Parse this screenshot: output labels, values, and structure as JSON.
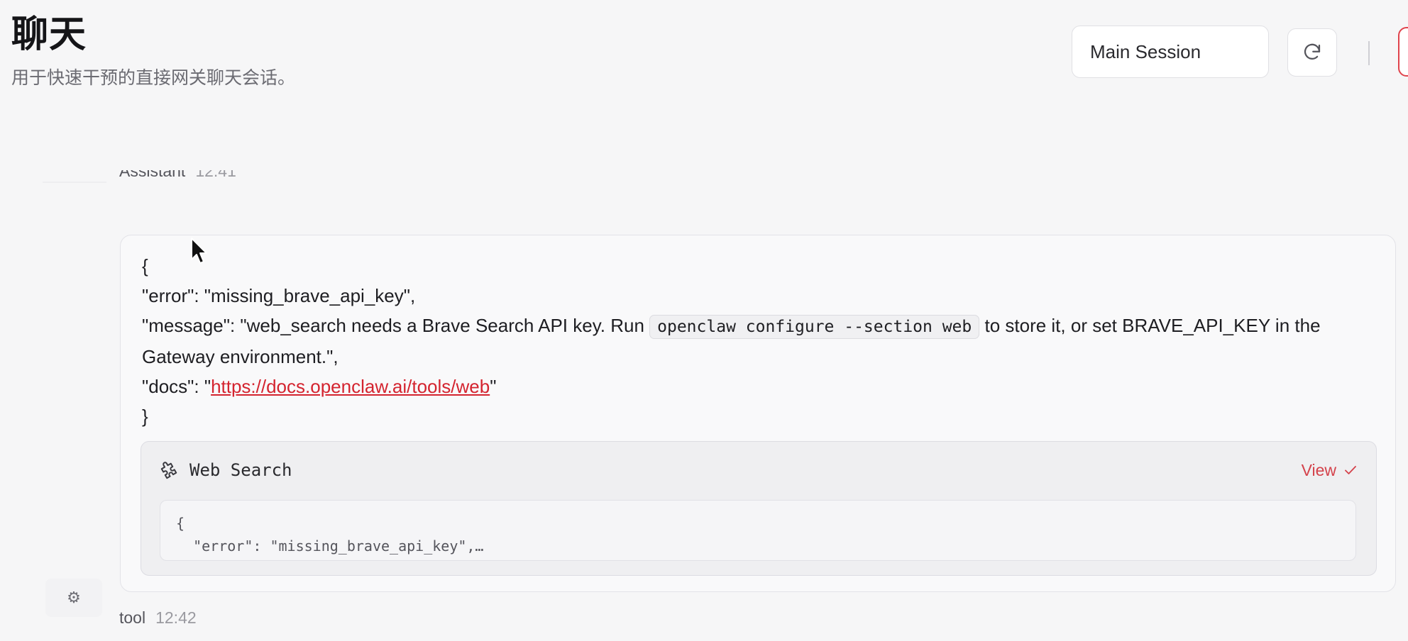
{
  "header": {
    "title": "聊天",
    "subtitle": "用于快速干预的直接网关聊天会话。",
    "session_select": "Main Session"
  },
  "messages": {
    "previous": {
      "sender": "Assistant",
      "time": "12:41"
    },
    "assistant": {
      "lines": {
        "open_brace": "{",
        "error_line": "\"error\": \"missing_brave_api_key\",",
        "message_prefix": "\"message\": \"web_search needs a Brave Search API key. Run ",
        "message_code": "openclaw configure --section web",
        "message_suffix": " to store it, or set BRAVE_API_KEY in the Gateway environment.\",",
        "docs_prefix": "\"docs\": \"",
        "docs_link": "https://docs.openclaw.ai/tools/web",
        "docs_suffix": "\"",
        "close_brace": "}"
      },
      "tool_card": {
        "name": "Web Search",
        "view_label": "View",
        "output_lines": [
          "{",
          "  \"error\": \"missing_brave_api_key\",…"
        ]
      }
    },
    "tool": {
      "sender": "tool",
      "time": "12:42",
      "avatar_icon": "⚙"
    }
  },
  "colors": {
    "accent": "#d4242f",
    "background": "#f6f6f7",
    "bubble": "#f9f9fa"
  },
  "icons": {
    "refresh": "refresh-icon",
    "tool": "puzzle-icon",
    "view_check": "check-icon",
    "tool_avatar": "gear-icon"
  }
}
